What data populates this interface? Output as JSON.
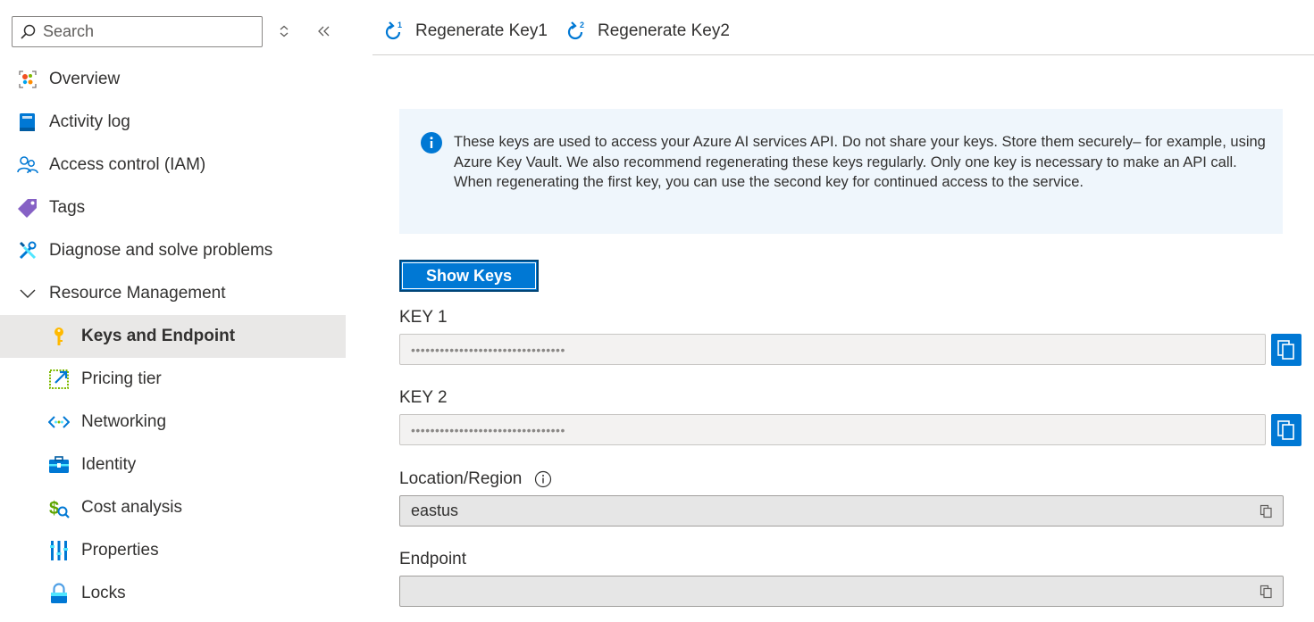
{
  "search": {
    "placeholder": "Search"
  },
  "sidebar": {
    "items": [
      {
        "label": "Overview",
        "icon": "overview-icon"
      },
      {
        "label": "Activity log",
        "icon": "activity-log-icon"
      },
      {
        "label": "Access control (IAM)",
        "icon": "people-icon"
      },
      {
        "label": "Tags",
        "icon": "tag-icon"
      },
      {
        "label": "Diagnose and solve problems",
        "icon": "wrench-icon"
      },
      {
        "label": "Resource Management",
        "icon": "chevron-down-icon"
      },
      {
        "label": "Keys and Endpoint",
        "icon": "key-icon",
        "selected": true
      },
      {
        "label": "Pricing tier",
        "icon": "pricing-tier-icon"
      },
      {
        "label": "Networking",
        "icon": "networking-icon"
      },
      {
        "label": "Identity",
        "icon": "identity-icon"
      },
      {
        "label": "Cost analysis",
        "icon": "cost-analysis-icon"
      },
      {
        "label": "Properties",
        "icon": "properties-icon"
      },
      {
        "label": "Locks",
        "icon": "lock-icon"
      }
    ]
  },
  "toolbar": {
    "regenerate_key1": "Regenerate Key1",
    "regenerate_key2": "Regenerate Key2"
  },
  "info": {
    "text": "These keys are used to access your Azure AI services API. Do not share your keys. Store them securely– for example, using Azure Key Vault. We also recommend regenerating these keys regularly. Only one key is necessary to make an API call. When regenerating the first key, you can use the second key for continued access to the service."
  },
  "show_keys_label": "Show Keys",
  "fields": {
    "key1_label": "KEY 1",
    "key1_value": "••••••••••••••••••••••••••••••••",
    "key2_label": "KEY 2",
    "key2_value": "••••••••••••••••••••••••••••••••",
    "location_label": "Location/Region",
    "location_value": "eastus",
    "endpoint_label": "Endpoint",
    "endpoint_value": ""
  },
  "colors": {
    "accent": "#0078d4",
    "info_bg": "#eff6fc",
    "selected_bg": "#e9e8e7"
  }
}
